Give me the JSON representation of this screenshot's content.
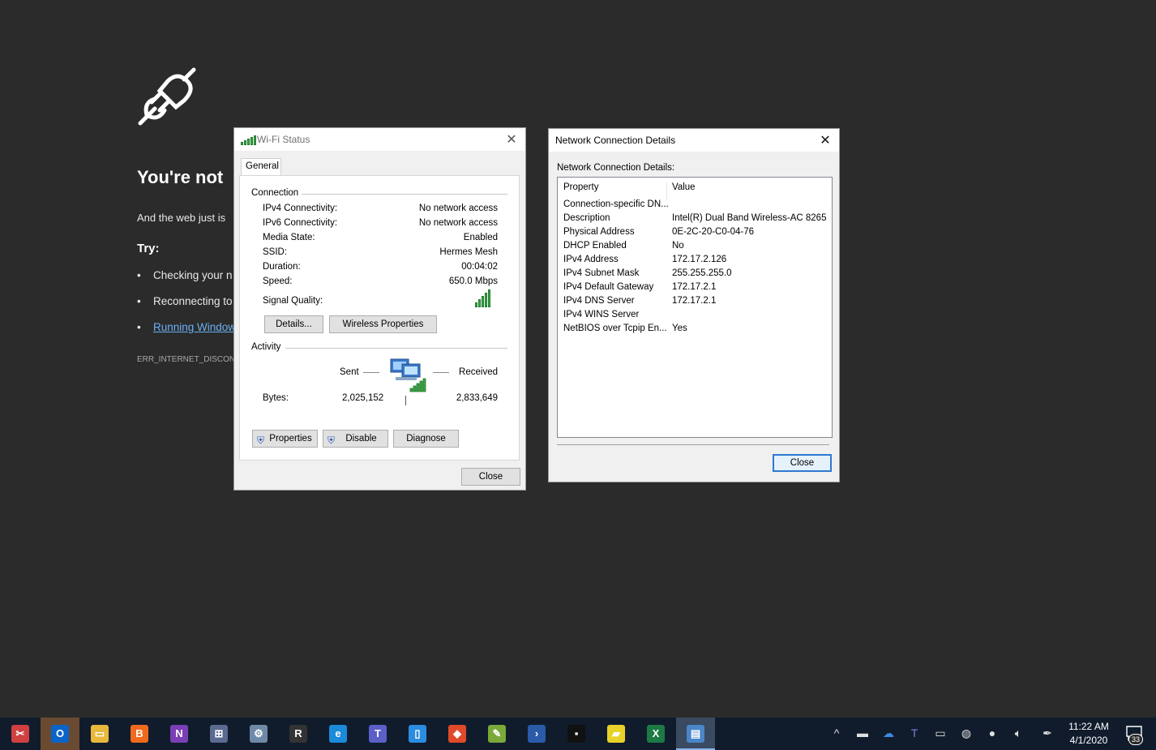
{
  "offline_page": {
    "title": "You're not",
    "subtitle": "And the web just is",
    "try_label": "Try:",
    "suggestions": [
      "Checking your n",
      "Reconnecting to"
    ],
    "link_suggestion": "Running Window",
    "error_code": "ERR_INTERNET_DISCONNE"
  },
  "wifi_status": {
    "title": "Wi-Fi Status",
    "tab": "General",
    "connection_label": "Connection",
    "rows": [
      {
        "label": "IPv4 Connectivity:",
        "value": "No network access"
      },
      {
        "label": "IPv6 Connectivity:",
        "value": "No network access"
      },
      {
        "label": "Media State:",
        "value": "Enabled"
      },
      {
        "label": "SSID:",
        "value": "Hermes Mesh"
      },
      {
        "label": "Duration:",
        "value": "00:04:02"
      },
      {
        "label": "Speed:",
        "value": "650.0 Mbps"
      }
    ],
    "signal_label": "Signal Quality:",
    "signal_level": 5,
    "details_button": "Details...",
    "wireless_props_button": "Wireless Properties",
    "activity_label": "Activity",
    "sent_label": "Sent",
    "received_label": "Received",
    "bytes_label": "Bytes:",
    "bytes_sent": "2,025,152",
    "bytes_received": "2,833,649",
    "properties_button": "Properties",
    "disable_button": "Disable",
    "diagnose_button": "Diagnose",
    "close_button": "Close"
  },
  "network_details": {
    "title": "Network Connection Details",
    "list_label": "Network Connection Details:",
    "col_property": "Property",
    "col_value": "Value",
    "rows": [
      {
        "property": "Connection-specific DN...",
        "value": ""
      },
      {
        "property": "Description",
        "value": "Intel(R) Dual Band Wireless-AC 8265"
      },
      {
        "property": "Physical Address",
        "value": "0E-2C-20-C0-04-76"
      },
      {
        "property": "DHCP Enabled",
        "value": "No"
      },
      {
        "property": "IPv4 Address",
        "value": "172.17.2.126"
      },
      {
        "property": "IPv4 Subnet Mask",
        "value": "255.255.255.0"
      },
      {
        "property": "IPv4 Default Gateway",
        "value": "172.17.2.1"
      },
      {
        "property": "IPv4 DNS Server",
        "value": "172.17.2.1"
      },
      {
        "property": "IPv4 WINS Server",
        "value": ""
      },
      {
        "property": "NetBIOS over Tcpip En...",
        "value": "Yes"
      }
    ],
    "close_button": "Close"
  },
  "taskbar": {
    "apps": [
      {
        "name": "snipping-tool-icon",
        "glyph": "✂",
        "color": "#d04040"
      },
      {
        "name": "outlook-icon",
        "glyph": "O",
        "color": "#0a64c8"
      },
      {
        "name": "file-explorer-icon",
        "glyph": "▭",
        "color": "#e8b73c"
      },
      {
        "name": "app-b-icon",
        "glyph": "B",
        "color": "#f06a1c"
      },
      {
        "name": "onenote-icon",
        "glyph": "N",
        "color": "#7b3fb5"
      },
      {
        "name": "network-monitor-icon",
        "glyph": "⊞",
        "color": "#5a6a90"
      },
      {
        "name": "network-app-icon",
        "glyph": "⚙",
        "color": "#6f8aa8"
      },
      {
        "name": "app-r-icon",
        "glyph": "R",
        "color": "#333"
      },
      {
        "name": "edge-icon",
        "glyph": "e",
        "color": "#1b8ad8"
      },
      {
        "name": "teams-icon",
        "glyph": "T",
        "color": "#5b5fc7"
      },
      {
        "name": "phone-app-icon",
        "glyph": "▯",
        "color": "#2b8ce0"
      },
      {
        "name": "paint-icon",
        "glyph": "◆",
        "color": "#e04a2a"
      },
      {
        "name": "chart-app-icon",
        "glyph": "✎",
        "color": "#7aa83a"
      },
      {
        "name": "powershell-icon",
        "glyph": "›",
        "color": "#2a5aa8"
      },
      {
        "name": "terminal-icon",
        "glyph": "▪",
        "color": "#111"
      },
      {
        "name": "sticky-notes-icon",
        "glyph": "▰",
        "color": "#e8d22a"
      },
      {
        "name": "excel-icon",
        "glyph": "X",
        "color": "#1d7a44"
      },
      {
        "name": "control-panel-icon",
        "glyph": "▤",
        "color": "#4a86c8"
      }
    ],
    "clock_time": "11:22 AM",
    "clock_date": "4/1/2020",
    "notification_count": "33"
  }
}
